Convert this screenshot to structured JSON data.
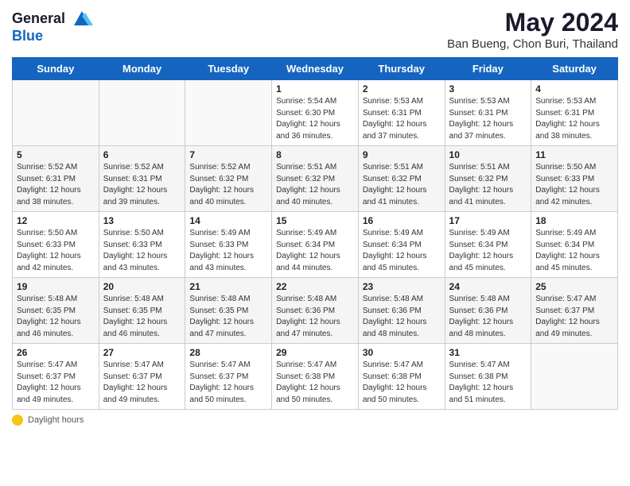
{
  "header": {
    "logo_line1": "General",
    "logo_line2": "Blue",
    "main_title": "May 2024",
    "subtitle": "Ban Bueng, Chon Buri, Thailand"
  },
  "days_of_week": [
    "Sunday",
    "Monday",
    "Tuesday",
    "Wednesday",
    "Thursday",
    "Friday",
    "Saturday"
  ],
  "weeks": [
    [
      {
        "day": "",
        "info": ""
      },
      {
        "day": "",
        "info": ""
      },
      {
        "day": "",
        "info": ""
      },
      {
        "day": "1",
        "info": "Sunrise: 5:54 AM\nSunset: 6:30 PM\nDaylight: 12 hours\nand 36 minutes."
      },
      {
        "day": "2",
        "info": "Sunrise: 5:53 AM\nSunset: 6:31 PM\nDaylight: 12 hours\nand 37 minutes."
      },
      {
        "day": "3",
        "info": "Sunrise: 5:53 AM\nSunset: 6:31 PM\nDaylight: 12 hours\nand 37 minutes."
      },
      {
        "day": "4",
        "info": "Sunrise: 5:53 AM\nSunset: 6:31 PM\nDaylight: 12 hours\nand 38 minutes."
      }
    ],
    [
      {
        "day": "5",
        "info": "Sunrise: 5:52 AM\nSunset: 6:31 PM\nDaylight: 12 hours\nand 38 minutes."
      },
      {
        "day": "6",
        "info": "Sunrise: 5:52 AM\nSunset: 6:31 PM\nDaylight: 12 hours\nand 39 minutes."
      },
      {
        "day": "7",
        "info": "Sunrise: 5:52 AM\nSunset: 6:32 PM\nDaylight: 12 hours\nand 40 minutes."
      },
      {
        "day": "8",
        "info": "Sunrise: 5:51 AM\nSunset: 6:32 PM\nDaylight: 12 hours\nand 40 minutes."
      },
      {
        "day": "9",
        "info": "Sunrise: 5:51 AM\nSunset: 6:32 PM\nDaylight: 12 hours\nand 41 minutes."
      },
      {
        "day": "10",
        "info": "Sunrise: 5:51 AM\nSunset: 6:32 PM\nDaylight: 12 hours\nand 41 minutes."
      },
      {
        "day": "11",
        "info": "Sunrise: 5:50 AM\nSunset: 6:33 PM\nDaylight: 12 hours\nand 42 minutes."
      }
    ],
    [
      {
        "day": "12",
        "info": "Sunrise: 5:50 AM\nSunset: 6:33 PM\nDaylight: 12 hours\nand 42 minutes."
      },
      {
        "day": "13",
        "info": "Sunrise: 5:50 AM\nSunset: 6:33 PM\nDaylight: 12 hours\nand 43 minutes."
      },
      {
        "day": "14",
        "info": "Sunrise: 5:49 AM\nSunset: 6:33 PM\nDaylight: 12 hours\nand 43 minutes."
      },
      {
        "day": "15",
        "info": "Sunrise: 5:49 AM\nSunset: 6:34 PM\nDaylight: 12 hours\nand 44 minutes."
      },
      {
        "day": "16",
        "info": "Sunrise: 5:49 AM\nSunset: 6:34 PM\nDaylight: 12 hours\nand 45 minutes."
      },
      {
        "day": "17",
        "info": "Sunrise: 5:49 AM\nSunset: 6:34 PM\nDaylight: 12 hours\nand 45 minutes."
      },
      {
        "day": "18",
        "info": "Sunrise: 5:49 AM\nSunset: 6:34 PM\nDaylight: 12 hours\nand 45 minutes."
      }
    ],
    [
      {
        "day": "19",
        "info": "Sunrise: 5:48 AM\nSunset: 6:35 PM\nDaylight: 12 hours\nand 46 minutes."
      },
      {
        "day": "20",
        "info": "Sunrise: 5:48 AM\nSunset: 6:35 PM\nDaylight: 12 hours\nand 46 minutes."
      },
      {
        "day": "21",
        "info": "Sunrise: 5:48 AM\nSunset: 6:35 PM\nDaylight: 12 hours\nand 47 minutes."
      },
      {
        "day": "22",
        "info": "Sunrise: 5:48 AM\nSunset: 6:36 PM\nDaylight: 12 hours\nand 47 minutes."
      },
      {
        "day": "23",
        "info": "Sunrise: 5:48 AM\nSunset: 6:36 PM\nDaylight: 12 hours\nand 48 minutes."
      },
      {
        "day": "24",
        "info": "Sunrise: 5:48 AM\nSunset: 6:36 PM\nDaylight: 12 hours\nand 48 minutes."
      },
      {
        "day": "25",
        "info": "Sunrise: 5:47 AM\nSunset: 6:37 PM\nDaylight: 12 hours\nand 49 minutes."
      }
    ],
    [
      {
        "day": "26",
        "info": "Sunrise: 5:47 AM\nSunset: 6:37 PM\nDaylight: 12 hours\nand 49 minutes."
      },
      {
        "day": "27",
        "info": "Sunrise: 5:47 AM\nSunset: 6:37 PM\nDaylight: 12 hours\nand 49 minutes."
      },
      {
        "day": "28",
        "info": "Sunrise: 5:47 AM\nSunset: 6:37 PM\nDaylight: 12 hours\nand 50 minutes."
      },
      {
        "day": "29",
        "info": "Sunrise: 5:47 AM\nSunset: 6:38 PM\nDaylight: 12 hours\nand 50 minutes."
      },
      {
        "day": "30",
        "info": "Sunrise: 5:47 AM\nSunset: 6:38 PM\nDaylight: 12 hours\nand 50 minutes."
      },
      {
        "day": "31",
        "info": "Sunrise: 5:47 AM\nSunset: 6:38 PM\nDaylight: 12 hours\nand 51 minutes."
      },
      {
        "day": "",
        "info": ""
      }
    ]
  ],
  "footer": {
    "daylight_label": "Daylight hours"
  }
}
